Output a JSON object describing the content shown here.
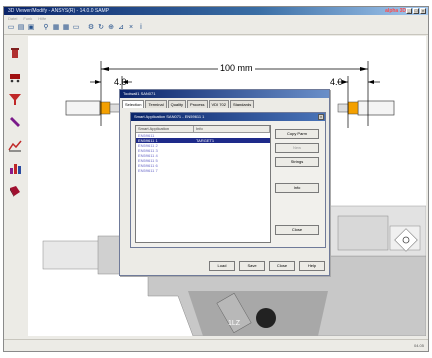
{
  "window": {
    "title": "3D Viewer/Modify - ANSYS(R) - 14.0.0 SAMP",
    "logo": "alpha 3D",
    "controls": [
      "_",
      "□",
      "×"
    ]
  },
  "menu": [
    "Datei",
    "Funk",
    "Hilfe"
  ],
  "toolbar": {
    "icons": [
      "new-icon",
      "open-icon",
      "save-icon",
      "filter-icon",
      "copy-icon",
      "grid-icon",
      "monitor-icon",
      "settings-icon",
      "rotate-icon",
      "zoom-icon",
      "measure-icon",
      "close-icon",
      "info-icon"
    ],
    "glyphs": [
      "▭",
      "▤",
      "▣",
      "⚲",
      "▦",
      "▦",
      "▭",
      "⚙",
      "↻",
      "⊕",
      "⊿",
      "×",
      "ⅰ"
    ]
  },
  "sidebar": {
    "icons": [
      "trash-icon",
      "cart-icon",
      "funnel-icon",
      "pencil-icon",
      "chart-icon",
      "bar-chart-icon",
      "book-icon"
    ]
  },
  "drawing": {
    "dimension_main": "100 mm",
    "dimension_left": "4.0",
    "dimension_right": "4.0",
    "part_label": "1LZ"
  },
  "outer_dialog": {
    "title": "Toolwall1 SAN071",
    "tabs": [
      "Selection",
      "Terminal",
      "Quality",
      "Process",
      "VDI 702",
      "Standards"
    ],
    "active_tab": 0,
    "buttons": [
      "Load",
      "Save",
      "Close",
      "Help"
    ]
  },
  "inner_dialog": {
    "title": "Smart Application SAN071 - EN59611 1",
    "columns": [
      "Smart Application",
      "Info"
    ],
    "rows": [
      {
        "name": "EN59611",
        "info": ""
      },
      {
        "name": "EN59611 1",
        "info": "TARGET1"
      },
      {
        "name": "EN59611 2",
        "info": ""
      },
      {
        "name": "EN59611 3",
        "info": ""
      },
      {
        "name": "EN59611 4",
        "info": ""
      },
      {
        "name": "EN59611 5",
        "info": ""
      },
      {
        "name": "EN59611 6",
        "info": ""
      },
      {
        "name": "EN59611 7",
        "info": ""
      }
    ],
    "selected_row": 1,
    "buttons": [
      {
        "label": "Copy Parm",
        "enabled": true
      },
      {
        "label": "New",
        "enabled": false
      },
      {
        "label": "Strings",
        "enabled": true
      },
      {
        "label": "Info",
        "enabled": true
      },
      {
        "label": "Close",
        "enabled": true
      }
    ]
  },
  "status": {
    "text": "04.05"
  }
}
